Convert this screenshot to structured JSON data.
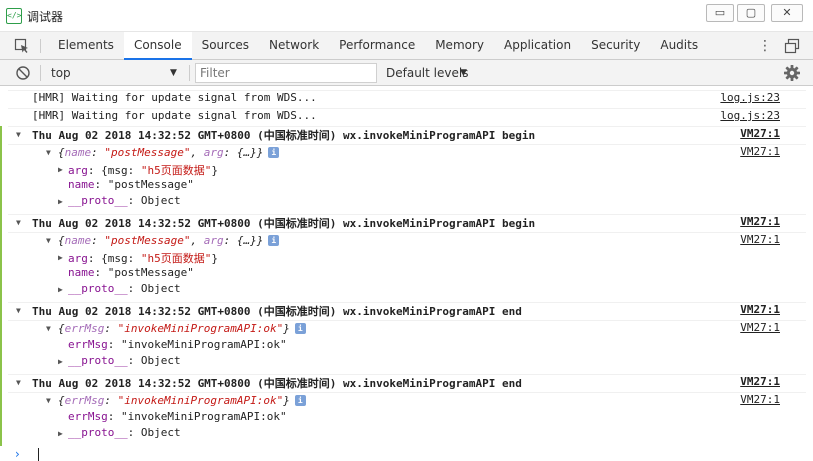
{
  "window": {
    "title": "调试器",
    "icon": "code-icon",
    "minimize": "▭",
    "maximize": "▢",
    "close": "✕"
  },
  "devtools": {
    "tabs": [
      "Elements",
      "Console",
      "Sources",
      "Network",
      "Performance",
      "Memory",
      "Application",
      "Security",
      "Audits"
    ],
    "active_tab": "Console",
    "more": "⋮"
  },
  "toolbar": {
    "context": "top",
    "filter_placeholder": "Filter",
    "levels": "Default levels"
  },
  "console": {
    "hmr1": "[HMR] Waiting for update signal from WDS...",
    "hmr1_src": "log.js:23",
    "hmr2": "[HMR] Waiting for update signal from WDS...",
    "hmr2_src": "log.js:23",
    "groups": [
      {
        "header": "Thu Aug 02 2018 14:32:52 GMT+0800 (中国标准时间) wx.invokeMiniProgramAPI begin",
        "header_src": "VM27:1",
        "summary_src": "VM27:1",
        "summary": {
          "open": "{",
          "k1": "name",
          "v1": "\"postMessage\"",
          "k2": "arg",
          "v2": "{…}",
          "close": "}"
        },
        "rows": [
          {
            "key": "arg",
            "value_prefix": "{msg: ",
            "value_str": "\"h5页面数据\"",
            "value_suffix": "}"
          },
          {
            "key": "name",
            "value_str": "\"postMessage\""
          },
          {
            "key": "__proto__",
            "value": "Object"
          }
        ]
      },
      {
        "header": "Thu Aug 02 2018 14:32:52 GMT+0800 (中国标准时间) wx.invokeMiniProgramAPI begin",
        "header_src": "VM27:1",
        "summary_src": "VM27:1",
        "summary": {
          "open": "{",
          "k1": "name",
          "v1": "\"postMessage\"",
          "k2": "arg",
          "v2": "{…}",
          "close": "}"
        },
        "rows": [
          {
            "key": "arg",
            "value_prefix": "{msg: ",
            "value_str": "\"h5页面数据\"",
            "value_suffix": "}"
          },
          {
            "key": "name",
            "value_str": "\"postMessage\""
          },
          {
            "key": "__proto__",
            "value": "Object"
          }
        ]
      },
      {
        "header": "Thu Aug 02 2018 14:32:52 GMT+0800 (中国标准时间) wx.invokeMiniProgramAPI end",
        "header_src": "VM27:1",
        "summary_src": "VM27:1",
        "summary": {
          "open": "{",
          "k1": "errMsg",
          "v1": "\"invokeMiniProgramAPI:ok\"",
          "close": "}"
        },
        "rows": [
          {
            "key": "errMsg",
            "value_str": "\"invokeMiniProgramAPI:ok\""
          },
          {
            "key": "__proto__",
            "value": "Object"
          }
        ]
      },
      {
        "header": "Thu Aug 02 2018 14:32:52 GMT+0800 (中国标准时间) wx.invokeMiniProgramAPI end",
        "header_src": "VM27:1",
        "summary_src": "VM27:1",
        "summary": {
          "open": "{",
          "k1": "errMsg",
          "v1": "\"invokeMiniProgramAPI:ok\"",
          "close": "}"
        },
        "rows": [
          {
            "key": "errMsg",
            "value_str": "\"invokeMiniProgramAPI:ok\""
          },
          {
            "key": "__proto__",
            "value": "Object"
          }
        ]
      }
    ],
    "prompt": "›",
    "info_badge": "i",
    "colon": ": ",
    "sep": ", ",
    "expanded_caret": "▼",
    "collapsed_caret": "▶"
  },
  "colors": {
    "active_tab_underline": "#1a73e8",
    "property_key": "#881391",
    "string_value": "#c41a16",
    "info_badge": "#7ba1d8"
  }
}
